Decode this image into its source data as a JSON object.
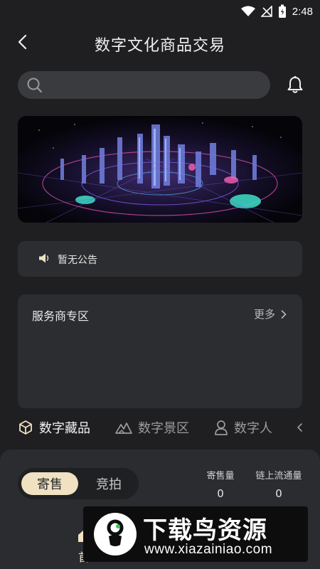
{
  "status_bar": {
    "time": "2:48",
    "icons": [
      "wifi-icon",
      "signal-icon",
      "battery-icon"
    ]
  },
  "header": {
    "title": "数字文化商品交易",
    "back_icon": "chevron-left-icon"
  },
  "search": {
    "placeholder": "",
    "icon": "search-icon"
  },
  "notifications": {
    "icon": "bell-icon"
  },
  "notice": {
    "text": "暂无公告",
    "icon": "speaker-icon"
  },
  "provider_section": {
    "title": "服务商专区",
    "more_label": "更多"
  },
  "category_tabs": [
    {
      "label": "数字藏品",
      "icon": "cube-icon",
      "active": true
    },
    {
      "label": "数字景区",
      "icon": "mountain-icon",
      "active": false
    },
    {
      "label": "数字人",
      "icon": "person-icon",
      "active": false
    }
  ],
  "trade_panel": {
    "modes": [
      {
        "label": "寄售",
        "active": true
      },
      {
        "label": "竞拍",
        "active": false
      }
    ],
    "stats": [
      {
        "label": "寄售量",
        "value": "0"
      },
      {
        "label": "链上流通量",
        "value": "0"
      }
    ]
  },
  "bottom_nav": {
    "home_label": "首"
  },
  "watermark": {
    "title": "下载鸟资源",
    "url": "www.xiazainiao.com"
  },
  "colors": {
    "accent": "#efe1c2",
    "background": "#1f1f21",
    "card": "#2c2d30"
  }
}
